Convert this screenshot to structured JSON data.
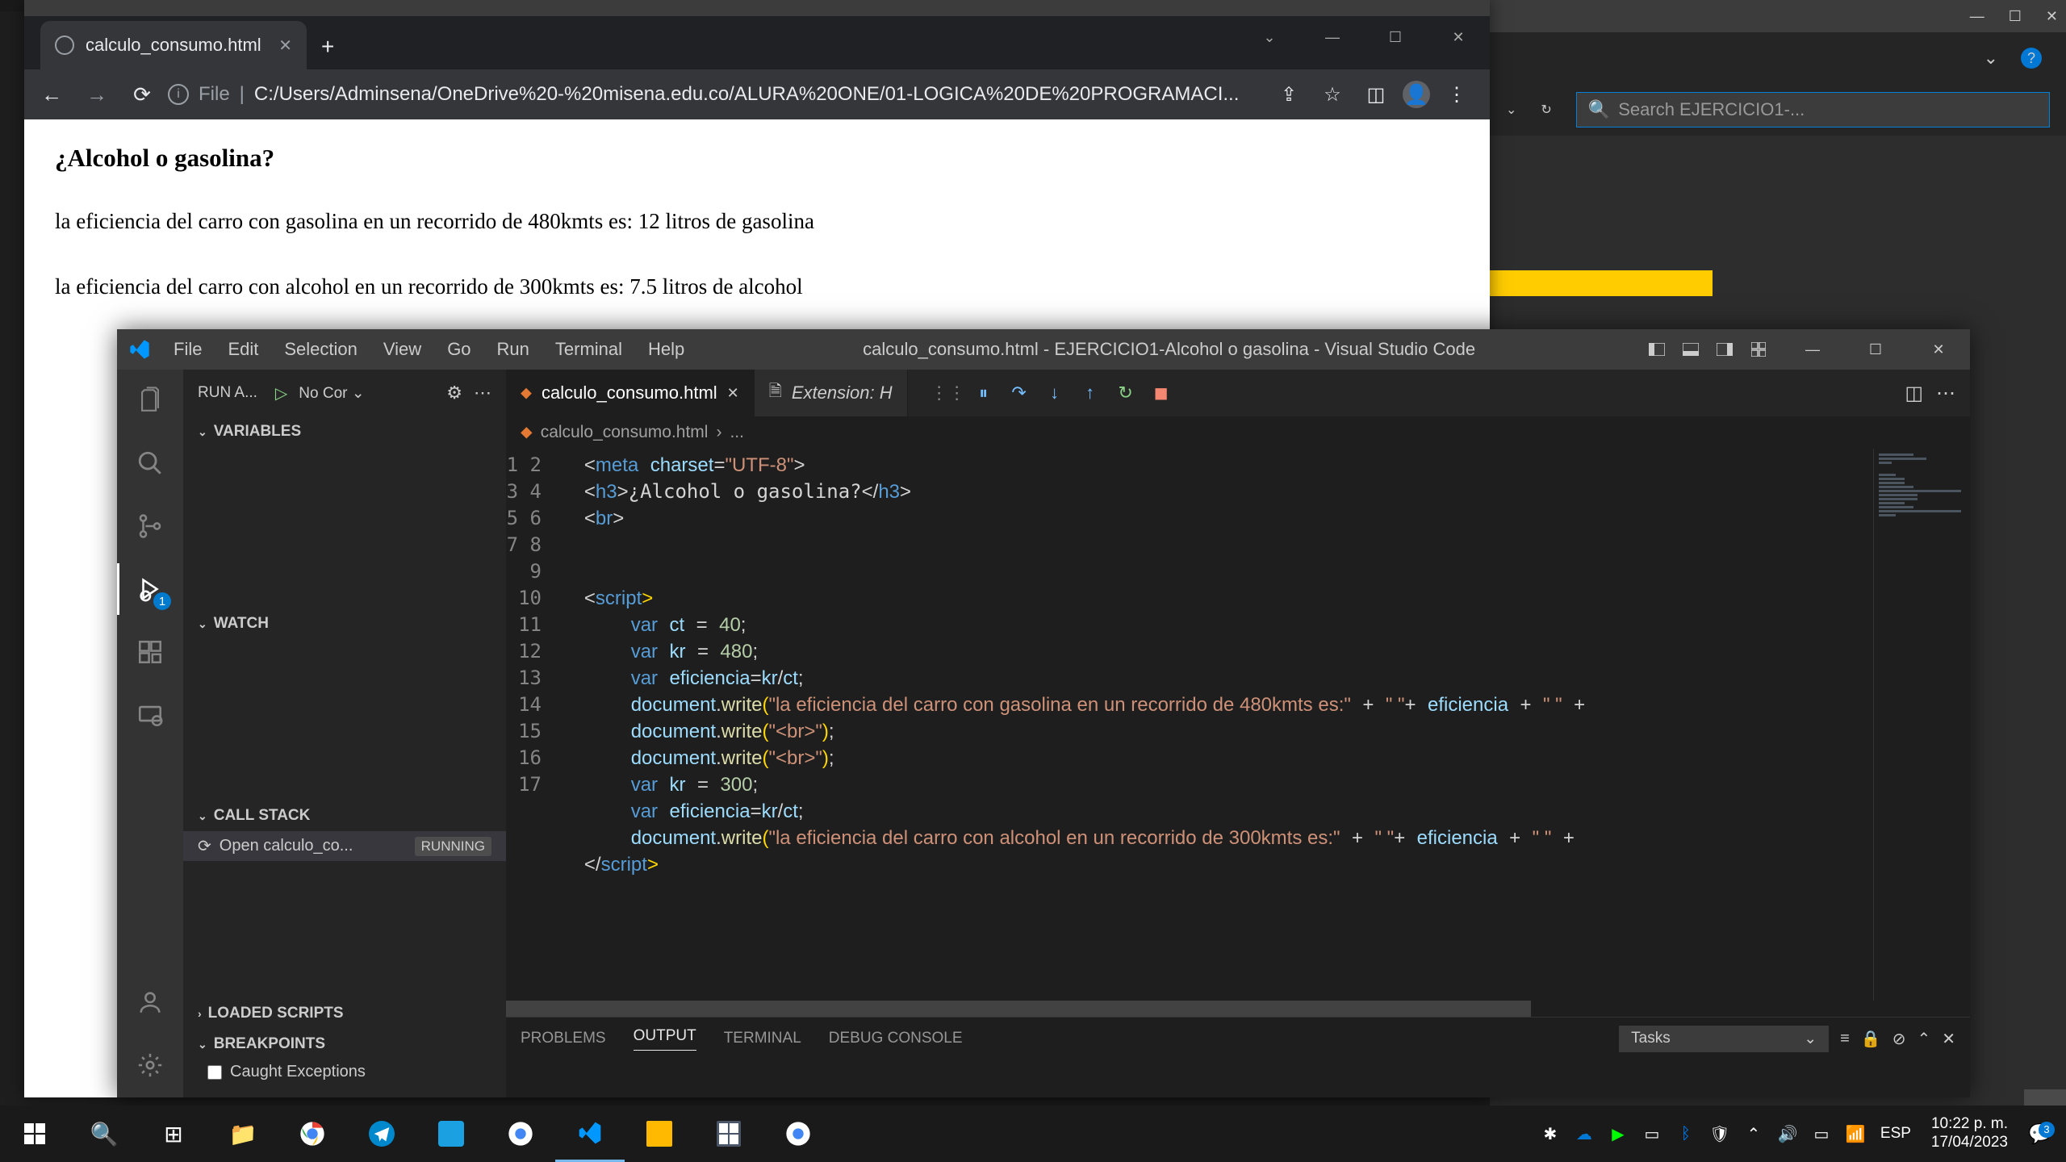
{
  "chrome": {
    "tab_title": "calculo_consumo.html",
    "file_label": "File",
    "url": "C:/Users/Adminsena/OneDrive%20-%20misena.edu.co/ALURA%20ONE/01-LOGICA%20DE%20PROGRAMACI...",
    "win_controls": {
      "dropdown": "⌄",
      "min": "—",
      "max": "☐",
      "close": "✕"
    }
  },
  "page": {
    "heading": "¿Alcohol o gasolina?",
    "line1": "la eficiencia del carro con gasolina en un recorrido de 480kmts es: 12 litros de gasolina",
    "line2": "la eficiencia del carro con alcohol en un recorrido de 300kmts es: 7.5 litros de alcohol"
  },
  "bg_app": {
    "search_placeholder": "Search EJERCICIO1-..."
  },
  "vscode": {
    "menu": [
      "File",
      "Edit",
      "Selection",
      "View",
      "Go",
      "Run",
      "Terminal",
      "Help"
    ],
    "title": "calculo_consumo.html - EJERCICIO1-Alcohol o gasolina - Visual Studio Code",
    "run_label": "RUN A...",
    "run_config": "No Cor",
    "sections": {
      "variables": "VARIABLES",
      "watch": "WATCH",
      "call_stack": "CALL STACK",
      "loaded_scripts": "LOADED SCRIPTS",
      "breakpoints": "BREAKPOINTS"
    },
    "call_stack_item": "Open calculo_co...",
    "call_stack_status": "RUNNING",
    "breakpoint_caught": "Caught Exceptions",
    "tabs": {
      "active": "calculo_consumo.html",
      "extension": "Extension: H"
    },
    "breadcrumb": "calculo_consumo.html",
    "breadcrumb_sep": "›",
    "breadcrumb_rest": "...",
    "panel_tabs": [
      "PROBLEMS",
      "OUTPUT",
      "TERMINAL",
      "DEBUG CONSOLE"
    ],
    "panel_tasks": "Tasks",
    "code": {
      "lines": [
        1,
        2,
        3,
        4,
        5,
        6,
        7,
        8,
        9,
        10,
        11,
        12,
        13,
        14,
        15,
        16,
        17
      ]
    },
    "debug_badge": "1"
  },
  "taskbar": {
    "lang": "ESP",
    "time": "10:22 p. m.",
    "date": "17/04/2023",
    "notif_count": "3"
  }
}
